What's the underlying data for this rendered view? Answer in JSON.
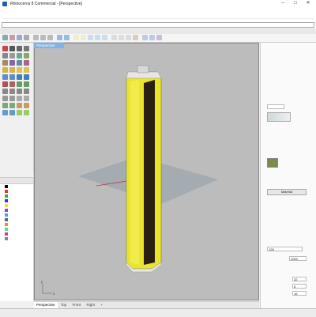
{
  "window": {
    "title": "Rhinoceros 8 Commercial - [Perspective]"
  },
  "viewport": {
    "active_tab": "Perspective",
    "axis_label_x": "x",
    "axis_label_y": "y"
  },
  "right_panel": {
    "material_preview": "Material",
    "field1": "",
    "value_128": "128",
    "value_1000": "1000",
    "value_32": "32",
    "value_8": "8",
    "value_16": "16"
  },
  "view_tabs": [
    "Perspective",
    "Top",
    "Front",
    "Right"
  ],
  "colors": {
    "accent": "#7eb3e6",
    "viewport_bg": "#bcbcbc",
    "ground": "#9aa4ad",
    "object_yellow": "#e9e52a",
    "object_dark": "#2a1f12"
  }
}
